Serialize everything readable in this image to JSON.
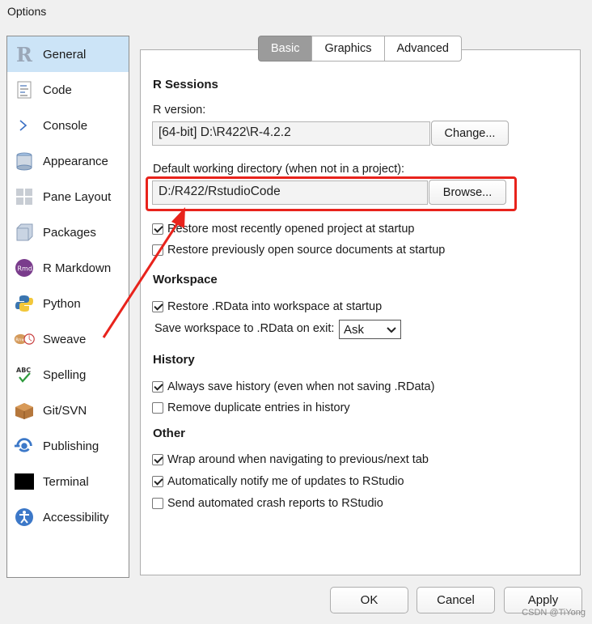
{
  "window": {
    "title": "Options"
  },
  "sidebar": {
    "items": [
      {
        "label": "General",
        "icon": "r-logo-icon",
        "selected": true
      },
      {
        "label": "Code",
        "icon": "code-document-icon"
      },
      {
        "label": "Console",
        "icon": "console-prompt-icon"
      },
      {
        "label": "Appearance",
        "icon": "appearance-icon"
      },
      {
        "label": "Pane Layout",
        "icon": "pane-layout-icon"
      },
      {
        "label": "Packages",
        "icon": "packages-icon"
      },
      {
        "label": "R Markdown",
        "icon": "rmarkdown-icon"
      },
      {
        "label": "Python",
        "icon": "python-icon"
      },
      {
        "label": "Sweave",
        "icon": "sweave-icon"
      },
      {
        "label": "Spelling",
        "icon": "spelling-icon"
      },
      {
        "label": "Git/SVN",
        "icon": "git-svn-icon"
      },
      {
        "label": "Publishing",
        "icon": "publishing-icon"
      },
      {
        "label": "Terminal",
        "icon": "terminal-icon"
      },
      {
        "label": "Accessibility",
        "icon": "accessibility-icon"
      }
    ]
  },
  "tabs": {
    "basic": "Basic",
    "graphics": "Graphics",
    "advanced": "Advanced",
    "active": "Basic"
  },
  "r_sessions": {
    "heading": "R Sessions",
    "r_version_label": "R version:",
    "r_version_value": "[64-bit] D:\\R422\\R-4.2.2",
    "change_button": "Change...",
    "workdir_label": "Default working directory (when not in a project):",
    "workdir_value": "D:/R422/RstudioCode",
    "browse_button": "Browse...",
    "restore_project": {
      "label": "Restore most recently opened project at startup",
      "checked": true
    },
    "restore_docs": {
      "label": "Restore previously open source documents at startup",
      "checked": false
    }
  },
  "workspace": {
    "heading": "Workspace",
    "restore_rdata": {
      "label": "Restore .RData into workspace at startup",
      "checked": true
    },
    "save_label": "Save workspace to .RData on exit:",
    "save_value": "Ask"
  },
  "history": {
    "heading": "History",
    "always_save": {
      "label": "Always save history (even when not saving .RData)",
      "checked": true
    },
    "remove_duplicates": {
      "label": "Remove duplicate entries in history",
      "checked": false
    }
  },
  "other": {
    "heading": "Other",
    "wrap_around": {
      "label": "Wrap around when navigating to previous/next tab",
      "checked": true
    },
    "notify_updates": {
      "label": "Automatically notify me of updates to RStudio",
      "checked": true
    },
    "crash_reports": {
      "label": "Send automated crash reports to RStudio",
      "checked": false
    }
  },
  "footer": {
    "ok": "OK",
    "cancel": "Cancel",
    "apply": "Apply"
  },
  "watermark": "CSDN @TiYong",
  "colors": {
    "highlight": "#e8231c",
    "selected_bg": "#cce4f7",
    "active_tab": "#9b9b9b"
  }
}
